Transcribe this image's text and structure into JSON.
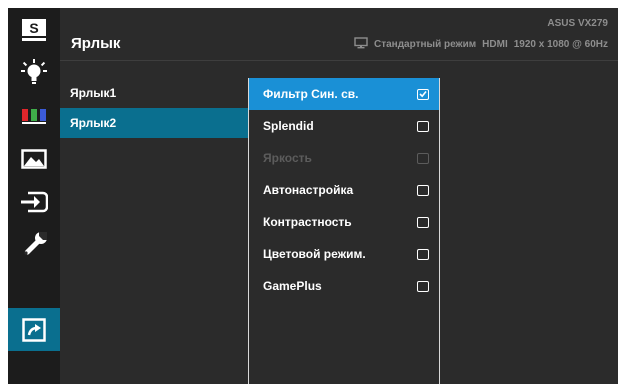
{
  "header": {
    "title": "Ярлык",
    "model": "ASUS VX279",
    "mode": "Стандартный режим",
    "input": "HDMI",
    "resolution": "1920 x 1080 @ 60Hz"
  },
  "rail": {
    "items": [
      {
        "name": "splendid-icon",
        "label": "S"
      },
      {
        "name": "blue-light-filter-icon"
      },
      {
        "name": "color-icon"
      },
      {
        "name": "image-icon"
      },
      {
        "name": "input-select-icon"
      },
      {
        "name": "system-setup-icon"
      },
      {
        "name": "shortcut-icon",
        "active": true
      }
    ]
  },
  "submenu": {
    "items": [
      {
        "label": "Ярлык1"
      },
      {
        "label": "Ярлык2",
        "active": true
      }
    ]
  },
  "options": {
    "items": [
      {
        "label": "Фильтр Син. св.",
        "checked": true,
        "active": true
      },
      {
        "label": "Splendid",
        "checked": false
      },
      {
        "label": "Яркость",
        "checked": false,
        "disabled": true
      },
      {
        "label": "Автонастройка",
        "checked": false
      },
      {
        "label": "Контрастность",
        "checked": false
      },
      {
        "label": "Цветовой режим.",
        "checked": false
      },
      {
        "label": "GamePlus",
        "checked": false
      }
    ]
  },
  "colors": {
    "accent_selected": "#1a90d6",
    "accent_active": "#0a6f8f",
    "background": "#2b2b2b"
  }
}
